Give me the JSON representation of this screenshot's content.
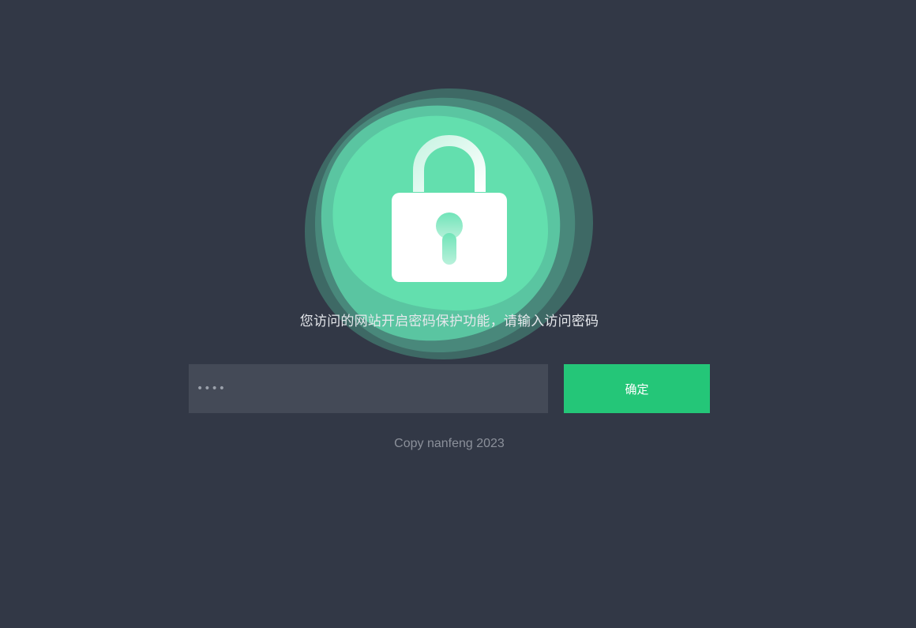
{
  "main": {
    "lock_icon": "padlock-icon",
    "message": "您访问的网站开启密码保护功能，请输入访问密码",
    "password": {
      "value": "",
      "placeholder": "••••"
    },
    "confirm_label": "确定",
    "copyright": "Copy nanfeng 2023"
  },
  "colors": {
    "background": "#323846",
    "accent": "#24c678",
    "input_background": "#444a57",
    "lock_green": "#63dfae"
  }
}
